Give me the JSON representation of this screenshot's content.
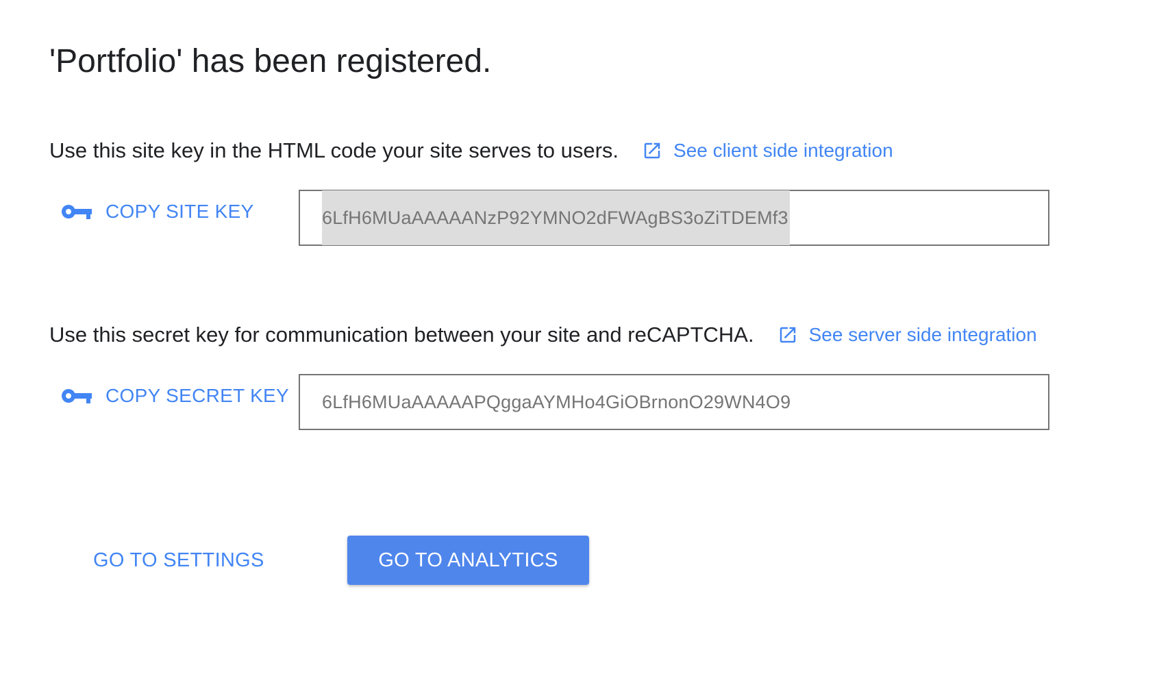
{
  "page": {
    "title": "'Portfolio' has been registered."
  },
  "site_key": {
    "description": "Use this site key in the HTML code your site serves to users.",
    "integration_link": "See client side integration",
    "copy_label": "COPY SITE KEY",
    "value": "6LfH6MUaAAAAANzP92YMNO2dFWAgBS3oZiTDEMf3"
  },
  "secret_key": {
    "description": "Use this secret key for communication between your site and reCAPTCHA.",
    "integration_link": "See server side integration",
    "copy_label": "COPY SECRET KEY",
    "value": "6LfH6MUaAAAAAPQggaAYMHo4GiOBrnonO29WN4O9"
  },
  "actions": {
    "settings_label": "GO TO SETTINGS",
    "analytics_label": "GO TO ANALYTICS"
  },
  "colors": {
    "accent": "#4285f4",
    "primary_button": "#4f86ec",
    "text": "#202124",
    "key_text": "#757575",
    "selection": "#dddddd"
  },
  "icons": {
    "external_link": "open-in-new-icon",
    "key": "key-icon"
  }
}
